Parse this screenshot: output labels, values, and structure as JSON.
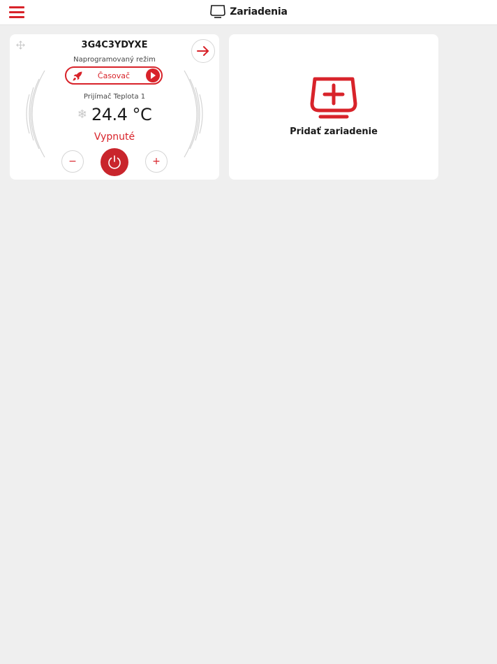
{
  "header": {
    "title": "Zariadenia",
    "menu_icon": "hamburger-menu-icon",
    "title_icon": "device-icon"
  },
  "devices": [
    {
      "name": "3G4C3YDYXE",
      "mode_label": "Naprogramovaný režim",
      "mode_value": "Časovač",
      "receiver_label": "Prijímač Teplota 1",
      "temperature": "24.4 °C",
      "status": "Vypnuté",
      "minus_symbol": "−",
      "plus_symbol": "+"
    }
  ],
  "add_device": {
    "label": "Pridať zariadenie"
  },
  "colors": {
    "accent": "#d8232a",
    "power_button": "#c9252c",
    "background": "#efefef",
    "card": "#ffffff"
  }
}
